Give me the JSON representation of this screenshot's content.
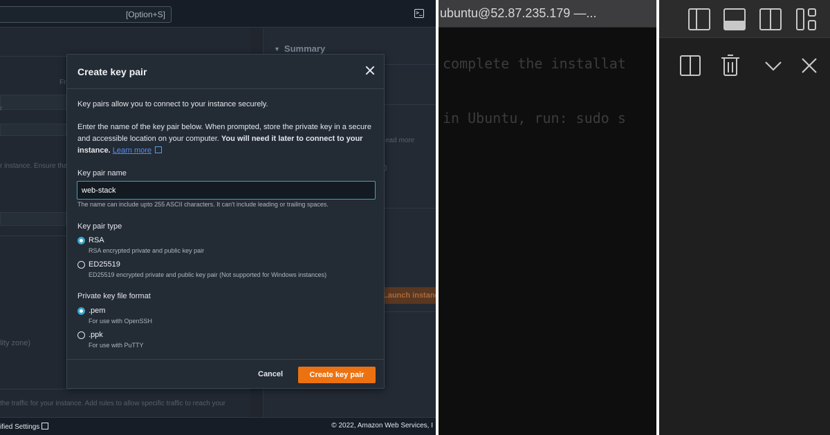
{
  "aws": {
    "search_shortcut": "[Option+S]",
    "background": {
      "summary_label": "Summary",
      "fragment_fr": "Fr",
      "fragment_r": "r",
      "instance_note": "r instance. Ensure that",
      "learn_more_fragment": "ead more",
      "paren_fragment": ")",
      "launch_button": "Launch instance",
      "zone_fragment": "lity zone)",
      "traffic_note": "the traffic for your instance. Add rules to allow specific traffic to reach your"
    },
    "footer": {
      "left": "ified Settings",
      "right": "© 2022, Amazon Web Services, I"
    },
    "modal": {
      "title": "Create key pair",
      "intro": "Key pairs allow you to connect to your instance securely.",
      "instructions": "Enter the name of the key pair below. When prompted, store the private key in a secure and accessible location on your computer.",
      "instructions_bold": "You will need it later to connect to your instance.",
      "learn_more": "Learn more",
      "name_label": "Key pair name",
      "name_value": "web-stack",
      "name_hint": "The name can include upto 255 ASCII characters. It can't include leading or trailing spaces.",
      "type_label": "Key pair type",
      "type_options": [
        {
          "label": "RSA",
          "desc": "RSA encrypted private and public key pair",
          "selected": true
        },
        {
          "label": "ED25519",
          "desc": "ED25519 encrypted private and public key pair (Not supported for Windows instances)",
          "selected": false
        }
      ],
      "format_label": "Private key file format",
      "format_options": [
        {
          "label": ".pem",
          "desc": "For use with OpenSSH",
          "selected": true
        },
        {
          "label": ".ppk",
          "desc": "For use with PuTTY",
          "selected": false
        }
      ],
      "cancel": "Cancel",
      "create": "Create key pair"
    }
  },
  "terminal": {
    "title": "ubuntu@52.87.235.179 —...",
    "lines": [
      "complete the installat",
      "in Ubuntu, run: sudo s"
    ]
  },
  "editor_toolbar": {
    "icons": [
      "toggle-primary-sidebar-icon",
      "toggle-panel-icon",
      "toggle-secondary-sidebar-icon",
      "customize-layout-icon",
      "split-terminal-icon",
      "trash-icon",
      "chevron-down-icon",
      "close-icon"
    ]
  },
  "colors": {
    "accent_orange": "#ec7211",
    "accent_blue": "#3aa5cf",
    "modal_bg": "#232b35",
    "terminal_bg": "#0e0e0e"
  }
}
